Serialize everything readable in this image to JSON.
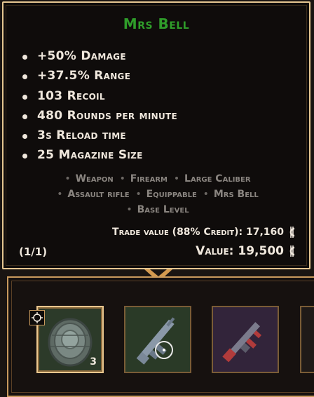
{
  "tooltip": {
    "title": "Mrs Bell",
    "stats": [
      "+50% Damage",
      "+37.5% Range",
      "103 Recoil",
      "480 Rounds per minute",
      "3s Reload time",
      "25 Magazine Size"
    ],
    "tags": [
      "Weapon",
      "Firearm",
      "Large Caliber",
      "Assault rifle",
      "Equippable",
      "Mrs Bell",
      "Base Level"
    ],
    "trade_value": "Trade value (88% Credit): 17,160",
    "value": "Value: 19,500",
    "page_count": "(1/1)",
    "colors": {
      "title": "#2f9d2a",
      "text": "#efe7dc",
      "tags": "#8a8580",
      "border": "#e5c691"
    }
  },
  "inventory": {
    "slots": [
      {
        "item": "landmine",
        "count": "3",
        "selected": true
      },
      {
        "item": "assault-rifle"
      },
      {
        "item": "tommy-gun"
      }
    ]
  }
}
